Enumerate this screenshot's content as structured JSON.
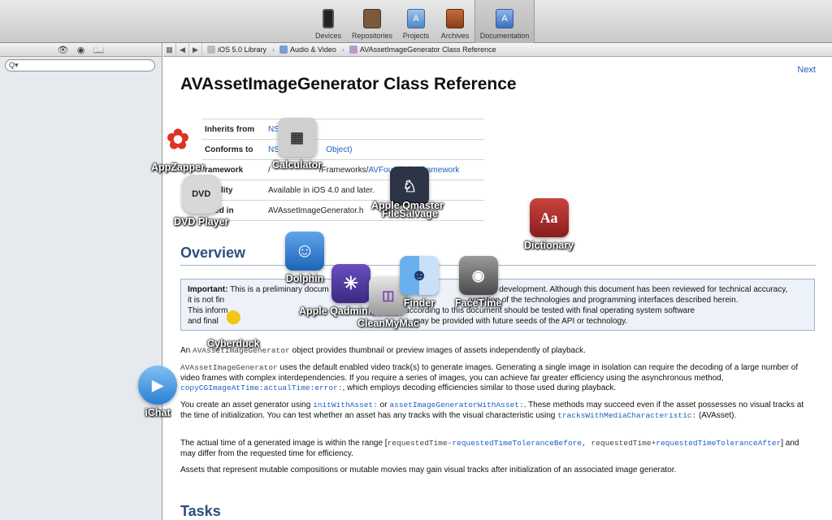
{
  "toolbar": {
    "items": [
      {
        "label": "Devices"
      },
      {
        "label": "Repositories"
      },
      {
        "label": "Projects"
      },
      {
        "label": "Archives"
      },
      {
        "label": "Documentation"
      }
    ]
  },
  "sidebar": {
    "search_placeholder": "Q▾"
  },
  "jumpbar": {
    "crumbs": [
      {
        "label": "iOS 5.0 Library"
      },
      {
        "label": "Audio & Video"
      },
      {
        "label": "AVAssetImageGenerator Class Reference"
      }
    ]
  },
  "content": {
    "next_label": "Next",
    "title": "AVAssetImageGenerator Class Reference",
    "info": [
      {
        "key": "Inherits from",
        "value": "NSOb"
      },
      {
        "key": "Conforms to",
        "value": "NSOb",
        "value2": "Object)"
      },
      {
        "key": "ramework",
        "value": "/",
        "value2": "/Frameworks/",
        "link": "AVFoundation.framework"
      },
      {
        "key": "ilability",
        "value": "Available in iOS 4.0 and later."
      },
      {
        "key": "lared in",
        "value": "AVAssetImageGenerator.h"
      }
    ],
    "overview_title": "Overview",
    "important": {
      "label": "Important:",
      "line1": "This is a preliminary docum",
      "line1b": "ogy in development. Although this document has been reviewed for technical accuracy,",
      "line2": "it is not fin",
      "line2b": "ormation of the technologies and programming interfaces described herein.",
      "line3": "This inform",
      "line3b": "ented according to this document should be tested with final operating system software",
      "line4": "and final",
      "line4b": "may be provided with future seeds of the API or technology."
    },
    "p1_pre": "An ",
    "p1_code": "AVAssetImageGenerator",
    "p1_post": " object provides thumbnail or preview images of assets independently of playback.",
    "p2_code": "AVAssetImageGenerator",
    "p2_text": " uses the default enabled video track(s) to generate images. Generating a single image in isolation can require the decoding of a large number of video frames with complex interdependencies. If you require a series of images, you can achieve far greater efficiency using the asynchronous method, ",
    "p2_link": "copyCGImageAtTime:actualTime:error:",
    "p2_end": ", which employs decoding efficiencies similar to those used during playback.",
    "p3_a": "You create an asset generator using ",
    "p3_link1": "initWithAsset:",
    "p3_b": " or ",
    "p3_link2": "assetImageGeneratorWithAsset:",
    "p3_c": ". These methods may succeed even if the asset possesses no visual tracks at the time of initialization. You can test whether an asset has any tracks with the visual characteristic using ",
    "p3_link3": "tracksWithMediaCharacteristic:",
    "p3_d": " (AVAsset).",
    "p4_a": "The actual time of a generated image is within the range [",
    "p4_c1": "requestedTime-",
    "p4_l1": "requestedTimeToleranceBefore",
    "p4_c2": ", requestedTime+",
    "p4_l2": "requestedTimeToleranceAfter",
    "p4_b": "] and may differ from the requested time for efficiency.",
    "p5": "Assets that represent mutable compositions or mutable movies may gain visual tracks after initialization of an associated image generator.",
    "tasks_title": "Tasks"
  },
  "apps": [
    {
      "label": "AppZapper"
    },
    {
      "label": "Calculator"
    },
    {
      "label": "DVD Player"
    },
    {
      "label": "FileSalvage"
    },
    {
      "label": "Apple Qmaster"
    },
    {
      "label": "Dictionary"
    },
    {
      "label": "Dolphin"
    },
    {
      "label": "Apple Qadministrator"
    },
    {
      "label": "CleanMyMac"
    },
    {
      "label": "Finder"
    },
    {
      "label": "FaceTime"
    },
    {
      "label": "Cyberduck"
    },
    {
      "label": "iChat"
    }
  ]
}
